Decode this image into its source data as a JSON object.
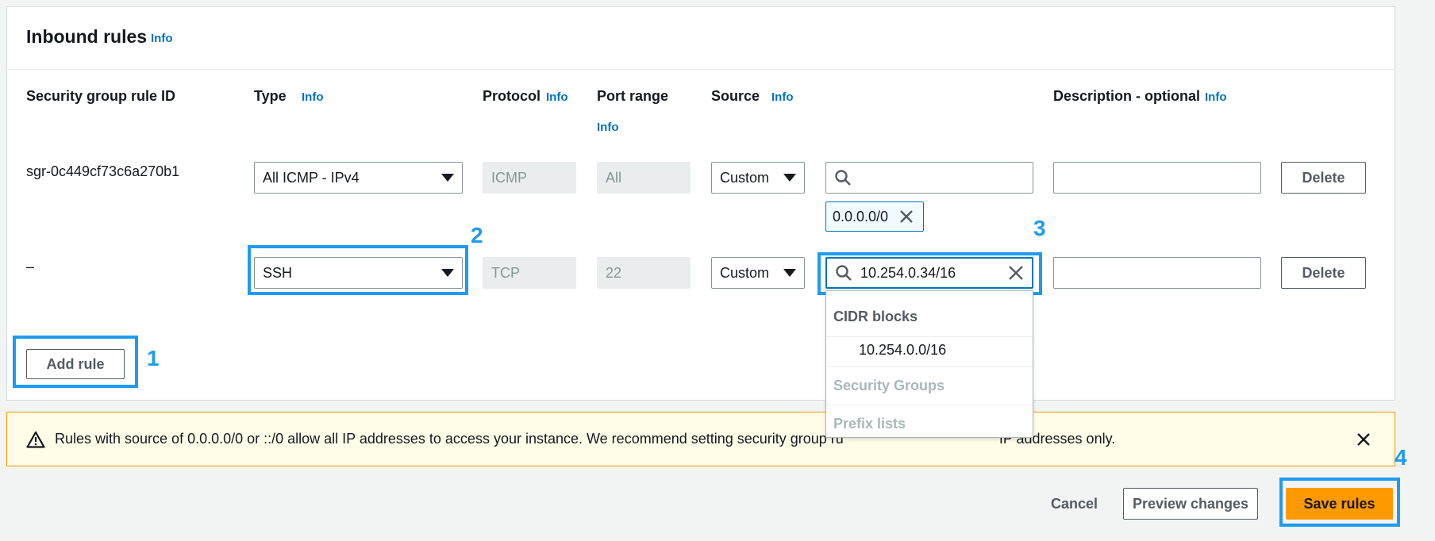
{
  "section": {
    "title": "Inbound rules",
    "info": "Info"
  },
  "columns": {
    "rule_id": "Security group rule ID",
    "type": "Type",
    "type_info": "Info",
    "protocol": "Protocol",
    "protocol_info": "Info",
    "port_range": "Port range",
    "port_info": "Info",
    "source": "Source",
    "source_info": "Info",
    "description": "Description - optional",
    "description_info": "Info"
  },
  "rows": [
    {
      "rule_id": "sgr-0c449cf73c6a270b1",
      "type": "All ICMP - IPv4",
      "protocol": "ICMP",
      "port_range": "All",
      "source_mode": "Custom",
      "source_search_value": "",
      "token": "0.0.0.0/0",
      "description": "",
      "delete_label": "Delete"
    },
    {
      "rule_id": "–",
      "type": "SSH",
      "protocol": "TCP",
      "port_range": "22",
      "source_mode": "Custom",
      "source_search_value": "10.254.0.34/16",
      "description": "",
      "delete_label": "Delete"
    }
  ],
  "source_dropdown": {
    "group_cidr": "CIDR blocks",
    "cidr_option": "10.254.0.0/16",
    "group_sg": "Security Groups",
    "group_prefix": "Prefix lists"
  },
  "add_rule_label": "Add rule",
  "warning": {
    "text_before": "Rules with source of 0.0.0.0/0 or ::/0 allow all IP addresses to access your instance. We recommend setting security group ru",
    "text_after": "IP addresses only."
  },
  "footer": {
    "cancel": "Cancel",
    "preview": "Preview changes",
    "save": "Save rules"
  },
  "annotations": {
    "n1": "1",
    "n2": "2",
    "n3": "3",
    "n4": "4"
  },
  "colors": {
    "accent": "#ff9900",
    "link": "#0073bb",
    "highlight": "#1e9bf0"
  }
}
